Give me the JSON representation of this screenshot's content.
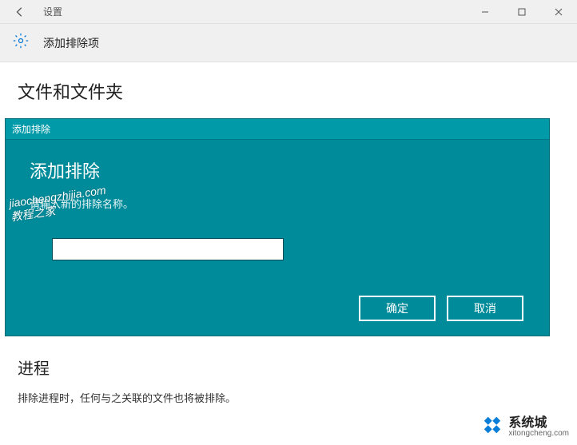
{
  "titlebar": {
    "title": "设置"
  },
  "header": {
    "title": "添加排除项"
  },
  "section1": {
    "title": "文件和文件夹"
  },
  "dialog": {
    "titlebar": "添加排除",
    "heading": "添加排除",
    "prompt": "请输入新的排除名称。",
    "input_value": "",
    "ok": "确定",
    "cancel": "取消"
  },
  "section2": {
    "title": "进程",
    "desc": "排除进程时，任何与之关联的文件也将被排除。"
  },
  "watermark": {
    "line1": "jiaochengzhijia.com",
    "line2": "教程之家"
  },
  "brand": {
    "name": "系统城",
    "url": "xitongcheng.com"
  }
}
